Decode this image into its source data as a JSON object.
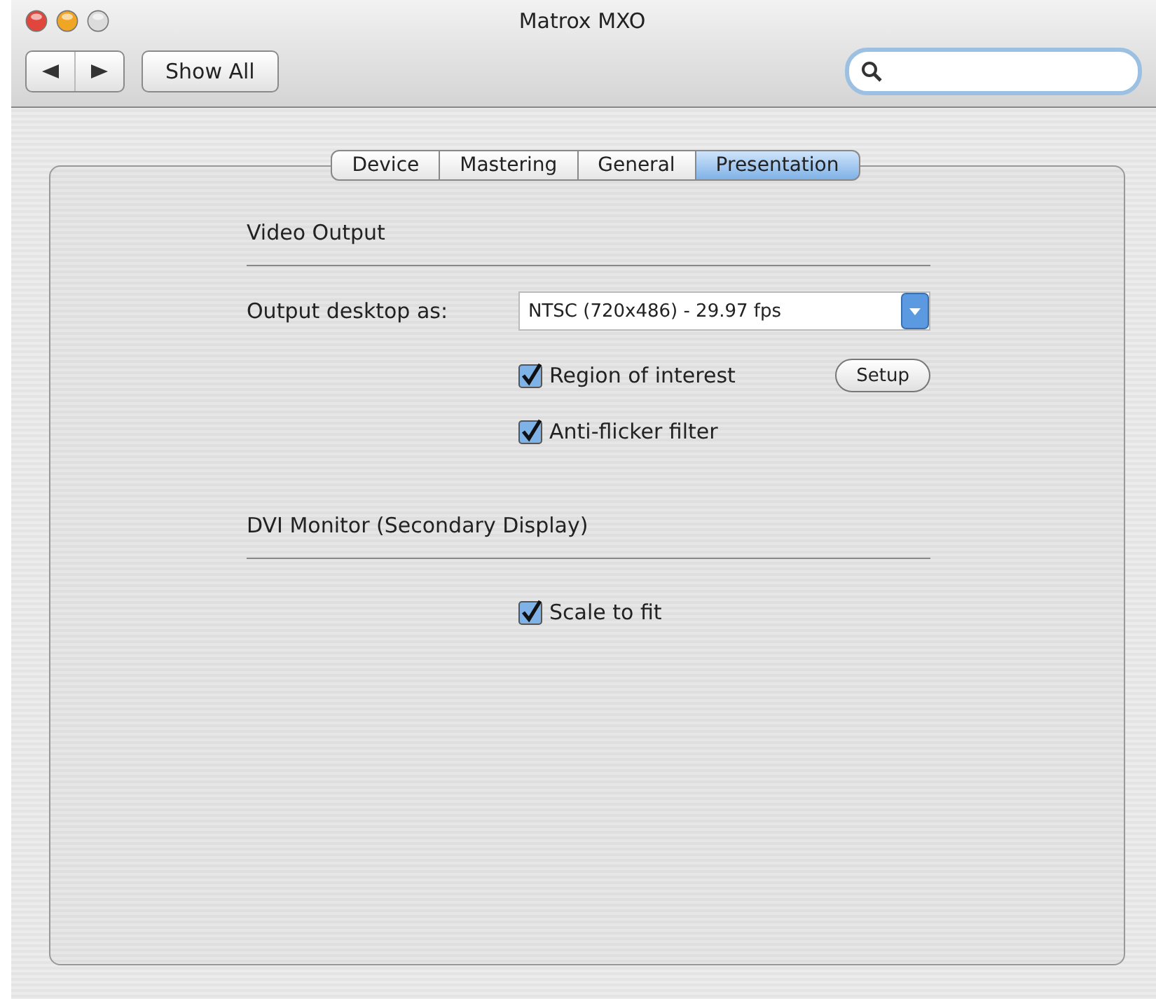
{
  "window": {
    "title": "Matrox MXO"
  },
  "toolbar": {
    "show_all": "Show All"
  },
  "tabs": [
    {
      "label": "Device",
      "selected": false
    },
    {
      "label": "Mastering",
      "selected": false
    },
    {
      "label": "General",
      "selected": false
    },
    {
      "label": "Presentation",
      "selected": true
    }
  ],
  "sections": [
    {
      "title": "Video Output",
      "rows": [
        {
          "kind": "select",
          "label": "Output desktop as:",
          "value": "NTSC (720x486) - 29.97 fps"
        },
        {
          "kind": "checkbox",
          "label": "Region of interest",
          "checked": true,
          "button": "Setup"
        },
        {
          "kind": "checkbox",
          "label": "Anti-flicker filter",
          "checked": true
        }
      ]
    },
    {
      "title": "DVI Monitor (Secondary Display)",
      "rows": [
        {
          "kind": "checkbox",
          "label": "Scale to fit",
          "checked": true
        }
      ]
    }
  ]
}
